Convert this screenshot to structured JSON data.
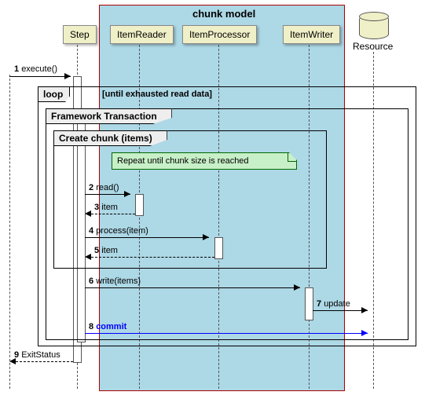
{
  "chunk_model_label": "chunk model",
  "participants": {
    "step": "Step",
    "reader": "ItemReader",
    "processor": "ItemProcessor",
    "writer": "ItemWriter",
    "resource": "Resource"
  },
  "frames": {
    "loop": {
      "label": "loop",
      "condition": "[until exhausted read data]"
    },
    "tx": {
      "label": "Framework Transaction"
    },
    "chunk": {
      "label": "Create chunk (items)"
    }
  },
  "note": "Repeat until chunk size is reached",
  "messages": {
    "m1": {
      "num": "1",
      "text": "execute()"
    },
    "m2": {
      "num": "2",
      "text": "read()"
    },
    "m3": {
      "num": "3",
      "text": "item"
    },
    "m4": {
      "num": "4",
      "text": "process(item)"
    },
    "m5": {
      "num": "5",
      "text": "item"
    },
    "m6": {
      "num": "6",
      "text": "write(items)"
    },
    "m7": {
      "num": "7",
      "text": "update"
    },
    "m8": {
      "num": "8",
      "text": "commit"
    },
    "m9": {
      "num": "9",
      "text": "ExitStatus"
    }
  },
  "colors": {
    "chunk_bg": "#add8e6",
    "participant_bg": "#f0f0c8",
    "note_bg": "#c8f0c8",
    "commit_color": "#0000ff"
  }
}
